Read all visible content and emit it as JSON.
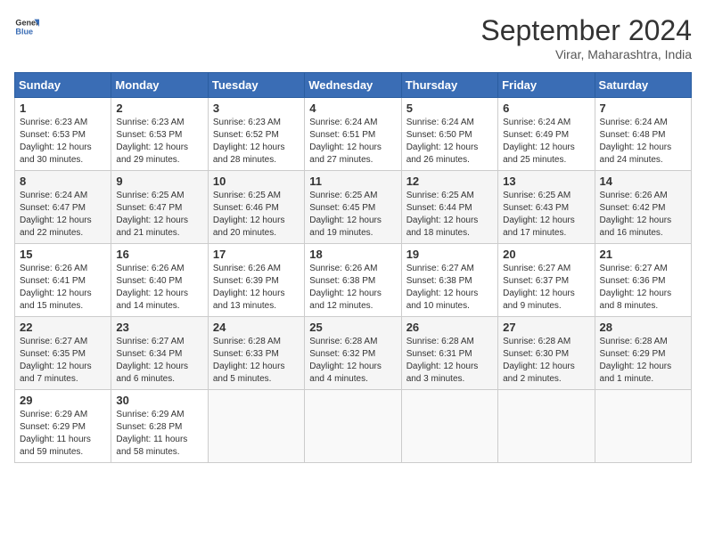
{
  "logo": {
    "line1": "General",
    "line2": "Blue"
  },
  "title": "September 2024",
  "subtitle": "Virar, Maharashtra, India",
  "days_of_week": [
    "Sunday",
    "Monday",
    "Tuesday",
    "Wednesday",
    "Thursday",
    "Friday",
    "Saturday"
  ],
  "weeks": [
    [
      {
        "day": "1",
        "sunrise": "6:23 AM",
        "sunset": "6:53 PM",
        "daylight": "12 hours and 30 minutes."
      },
      {
        "day": "2",
        "sunrise": "6:23 AM",
        "sunset": "6:53 PM",
        "daylight": "12 hours and 29 minutes."
      },
      {
        "day": "3",
        "sunrise": "6:23 AM",
        "sunset": "6:52 PM",
        "daylight": "12 hours and 28 minutes."
      },
      {
        "day": "4",
        "sunrise": "6:24 AM",
        "sunset": "6:51 PM",
        "daylight": "12 hours and 27 minutes."
      },
      {
        "day": "5",
        "sunrise": "6:24 AM",
        "sunset": "6:50 PM",
        "daylight": "12 hours and 26 minutes."
      },
      {
        "day": "6",
        "sunrise": "6:24 AM",
        "sunset": "6:49 PM",
        "daylight": "12 hours and 25 minutes."
      },
      {
        "day": "7",
        "sunrise": "6:24 AM",
        "sunset": "6:48 PM",
        "daylight": "12 hours and 24 minutes."
      }
    ],
    [
      {
        "day": "8",
        "sunrise": "6:24 AM",
        "sunset": "6:47 PM",
        "daylight": "12 hours and 22 minutes."
      },
      {
        "day": "9",
        "sunrise": "6:25 AM",
        "sunset": "6:47 PM",
        "daylight": "12 hours and 21 minutes."
      },
      {
        "day": "10",
        "sunrise": "6:25 AM",
        "sunset": "6:46 PM",
        "daylight": "12 hours and 20 minutes."
      },
      {
        "day": "11",
        "sunrise": "6:25 AM",
        "sunset": "6:45 PM",
        "daylight": "12 hours and 19 minutes."
      },
      {
        "day": "12",
        "sunrise": "6:25 AM",
        "sunset": "6:44 PM",
        "daylight": "12 hours and 18 minutes."
      },
      {
        "day": "13",
        "sunrise": "6:25 AM",
        "sunset": "6:43 PM",
        "daylight": "12 hours and 17 minutes."
      },
      {
        "day": "14",
        "sunrise": "6:26 AM",
        "sunset": "6:42 PM",
        "daylight": "12 hours and 16 minutes."
      }
    ],
    [
      {
        "day": "15",
        "sunrise": "6:26 AM",
        "sunset": "6:41 PM",
        "daylight": "12 hours and 15 minutes."
      },
      {
        "day": "16",
        "sunrise": "6:26 AM",
        "sunset": "6:40 PM",
        "daylight": "12 hours and 14 minutes."
      },
      {
        "day": "17",
        "sunrise": "6:26 AM",
        "sunset": "6:39 PM",
        "daylight": "12 hours and 13 minutes."
      },
      {
        "day": "18",
        "sunrise": "6:26 AM",
        "sunset": "6:38 PM",
        "daylight": "12 hours and 12 minutes."
      },
      {
        "day": "19",
        "sunrise": "6:27 AM",
        "sunset": "6:38 PM",
        "daylight": "12 hours and 10 minutes."
      },
      {
        "day": "20",
        "sunrise": "6:27 AM",
        "sunset": "6:37 PM",
        "daylight": "12 hours and 9 minutes."
      },
      {
        "day": "21",
        "sunrise": "6:27 AM",
        "sunset": "6:36 PM",
        "daylight": "12 hours and 8 minutes."
      }
    ],
    [
      {
        "day": "22",
        "sunrise": "6:27 AM",
        "sunset": "6:35 PM",
        "daylight": "12 hours and 7 minutes."
      },
      {
        "day": "23",
        "sunrise": "6:27 AM",
        "sunset": "6:34 PM",
        "daylight": "12 hours and 6 minutes."
      },
      {
        "day": "24",
        "sunrise": "6:28 AM",
        "sunset": "6:33 PM",
        "daylight": "12 hours and 5 minutes."
      },
      {
        "day": "25",
        "sunrise": "6:28 AM",
        "sunset": "6:32 PM",
        "daylight": "12 hours and 4 minutes."
      },
      {
        "day": "26",
        "sunrise": "6:28 AM",
        "sunset": "6:31 PM",
        "daylight": "12 hours and 3 minutes."
      },
      {
        "day": "27",
        "sunrise": "6:28 AM",
        "sunset": "6:30 PM",
        "daylight": "12 hours and 2 minutes."
      },
      {
        "day": "28",
        "sunrise": "6:28 AM",
        "sunset": "6:29 PM",
        "daylight": "12 hours and 1 minute."
      }
    ],
    [
      {
        "day": "29",
        "sunrise": "6:29 AM",
        "sunset": "6:29 PM",
        "daylight": "11 hours and 59 minutes."
      },
      {
        "day": "30",
        "sunrise": "6:29 AM",
        "sunset": "6:28 PM",
        "daylight": "11 hours and 58 minutes."
      },
      null,
      null,
      null,
      null,
      null
    ]
  ]
}
